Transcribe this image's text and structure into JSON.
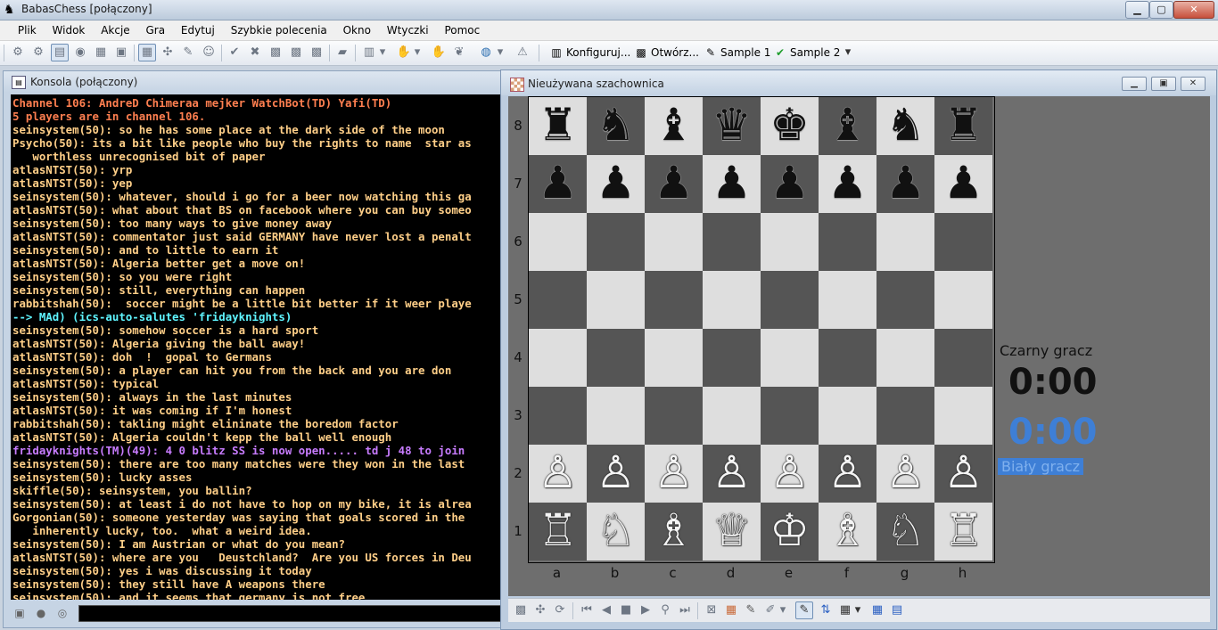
{
  "app": {
    "title": "BabasChess [połączony]",
    "icon": "app-logo-icon",
    "controls": {
      "minimize": "▁",
      "maximize": "▢",
      "close": "✕"
    }
  },
  "menu": [
    "Plik",
    "Widok",
    "Akcje",
    "Gra",
    "Edytuj",
    "Szybkie polecenia",
    "Okno",
    "Wtyczki",
    "Pomoc"
  ],
  "toolbar": {
    "text_buttons": [
      {
        "label": "Konfiguruj...",
        "icon": "configure-icon"
      },
      {
        "label": "Otwórz...",
        "icon": "open-icon"
      },
      {
        "label": "Sample 1",
        "icon": "sample-edit-icon"
      },
      {
        "label": "Sample 2",
        "icon": "checkmark-icon"
      }
    ]
  },
  "console": {
    "title": "Konsola (połączony)",
    "colors": {
      "bg": "#000000",
      "channel": "#ff7f50",
      "tell": "#ffcf88",
      "system": "#5ff5ff",
      "announce": "#c87cff"
    },
    "lines": [
      {
        "text": "Channel 106: AndreD Chimeraa mejker WatchBot(TD) Yafi(TD)",
        "color": "channel"
      },
      {
        "text": "5 players are in channel 106.",
        "color": "channel"
      },
      {
        "text": "seinsystem(50): so he has some place at the dark side of the moon",
        "color": "tell"
      },
      {
        "text": "Psycho(50): its a bit like people who buy the rights to name  star as",
        "color": "tell"
      },
      {
        "text": "   worthless unrecognised bit of paper",
        "color": "tell"
      },
      {
        "text": "atlasNTST(50): yrp",
        "color": "tell"
      },
      {
        "text": "atlasNTST(50): yep",
        "color": "tell"
      },
      {
        "text": "seinsystem(50): whatever, should i go for a beer now watching this ga",
        "color": "tell"
      },
      {
        "text": "atlasNTST(50): what about that BS on facebook where you can buy someo",
        "color": "tell"
      },
      {
        "text": "seinsystem(50): too many ways to give money away",
        "color": "tell"
      },
      {
        "text": "atlasNTST(50): commentator just said GERMANY have never lost a penalt",
        "color": "tell"
      },
      {
        "text": "seinsystem(50): and to little to earn it",
        "color": "tell"
      },
      {
        "text": "atlasNTST(50): Algeria better get a move on!",
        "color": "tell"
      },
      {
        "text": "seinsystem(50): so you were right",
        "color": "tell"
      },
      {
        "text": "seinsystem(50): still, everything can happen",
        "color": "tell"
      },
      {
        "text": "rabbitshah(50):  soccer might be a little bit better if it weer playe",
        "color": "tell"
      },
      {
        "text": "--> MAd) (ics-auto-salutes 'fridayknights)",
        "color": "system"
      },
      {
        "text": "seinsystem(50): somehow soccer is a hard sport",
        "color": "tell"
      },
      {
        "text": "atlasNTST(50): Algeria giving the ball away!",
        "color": "tell"
      },
      {
        "text": "atlasNTST(50): doh  !  gopal to Germans",
        "color": "tell"
      },
      {
        "text": "seinsystem(50): a player can hit you from the back and you are don",
        "color": "tell"
      },
      {
        "text": "atlasNTST(50): typical",
        "color": "tell"
      },
      {
        "text": "seinsystem(50): always in the last minutes",
        "color": "tell"
      },
      {
        "text": "atlasNTST(50): it was coming if I'm honest",
        "color": "tell"
      },
      {
        "text": "rabbitshah(50): takling might elininate the boredom factor",
        "color": "tell"
      },
      {
        "text": "atlasNTST(50): Algeria couldn't kepp the ball well enough",
        "color": "tell"
      },
      {
        "text": "fridayknights(TM)(49): 4 0 blitz SS is now open..... td j 48 to join",
        "color": "announce"
      },
      {
        "text": "seinsystem(50): there are too many matches were they won in the last",
        "color": "tell"
      },
      {
        "text": "seinsystem(50): lucky asses",
        "color": "tell"
      },
      {
        "text": "skiffle(50): seinsystem, you ballin?",
        "color": "tell"
      },
      {
        "text": "seinsystem(50): at least i do not have to hop on my bike, it is alrea",
        "color": "tell"
      },
      {
        "text": "Gorgonian(50): someone yesterday was saying that goals scored in the",
        "color": "tell"
      },
      {
        "text": "   inherently lucky, too.  what a weird idea.",
        "color": "tell"
      },
      {
        "text": "seinsystem(50): I am Austrian or what do you mean?",
        "color": "tell"
      },
      {
        "text": "atlasNTST(50): where are you   Deustchland?  Are you US forces in Deu",
        "color": "tell"
      },
      {
        "text": "seinsystem(50): yes i was discussing it today",
        "color": "tell"
      },
      {
        "text": "seinsystem(50): they still have A weapons there",
        "color": "tell"
      },
      {
        "text": "seinsystem(50): and it seems that germany is not free",
        "color": "tell"
      }
    ],
    "input_value": ""
  },
  "board": {
    "title": "Nieużywana szachownica",
    "ranks": [
      "8",
      "7",
      "6",
      "5",
      "4",
      "3",
      "2",
      "1"
    ],
    "files": [
      "a",
      "b",
      "c",
      "d",
      "e",
      "f",
      "g",
      "h"
    ],
    "position": [
      [
        "♜",
        "♞",
        "♝",
        "♛",
        "♚",
        "♝",
        "♞",
        "♜"
      ],
      [
        "♟",
        "♟",
        "♟",
        "♟",
        "♟",
        "♟",
        "♟",
        "♟"
      ],
      [
        "",
        "",
        "",
        "",
        "",
        "",
        "",
        ""
      ],
      [
        "",
        "",
        "",
        "",
        "",
        "",
        "",
        ""
      ],
      [
        "",
        "",
        "",
        "",
        "",
        "",
        "",
        ""
      ],
      [
        "",
        "",
        "",
        "",
        "",
        "",
        "",
        ""
      ],
      [
        "♙",
        "♙",
        "♙",
        "♙",
        "♙",
        "♙",
        "♙",
        "♙"
      ],
      [
        "♖",
        "♘",
        "♗",
        "♕",
        "♔",
        "♗",
        "♘",
        "♖"
      ]
    ],
    "black_player": {
      "name": "Czarny gracz",
      "clock": "0:00",
      "color": "#111111"
    },
    "white_player": {
      "name": "Biały gracz",
      "clock": "0:00",
      "color": "#3e7fd6"
    }
  }
}
